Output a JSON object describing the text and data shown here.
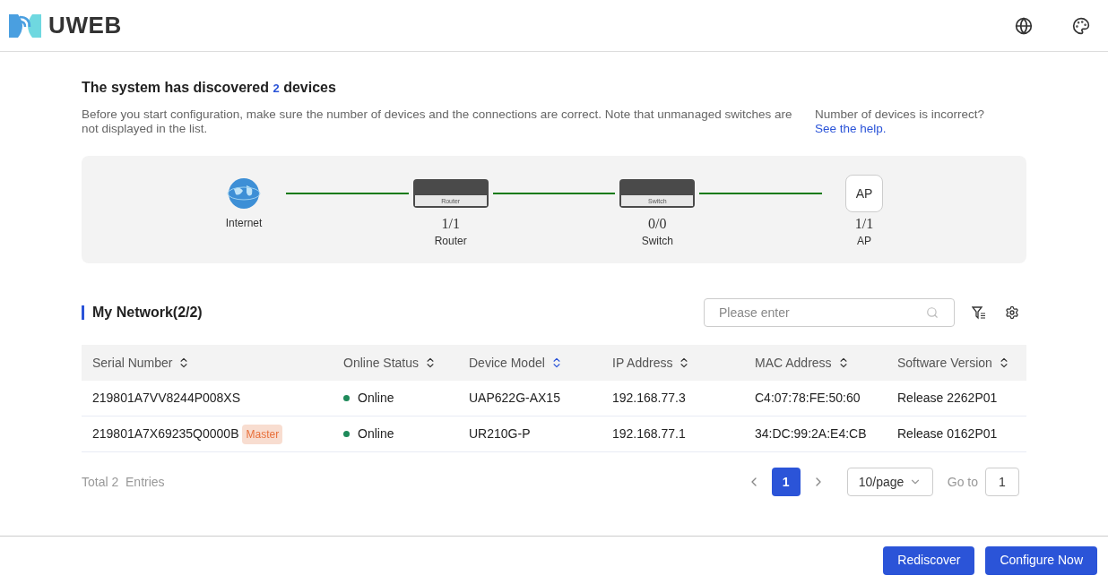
{
  "header": {
    "logo_text": "UWEB"
  },
  "discovery": {
    "title_before": "The system has discovered",
    "count": "2",
    "title_after": "devices",
    "description": "Before you start configuration, make sure the number of devices and the connections are correct. Note that unmanaged switches are not displayed in the list.",
    "help_question": "Number of devices is incorrect?",
    "help_link": "See the help."
  },
  "topology": [
    {
      "kind": "internet",
      "label": "Internet"
    },
    {
      "kind": "router",
      "device_label": "Router",
      "count": "1/1",
      "label": "Router"
    },
    {
      "kind": "switch",
      "device_label": "Switch",
      "count": "0/0",
      "label": "Switch"
    },
    {
      "kind": "ap",
      "device_label": "AP",
      "count": "1/1",
      "label": "AP"
    }
  ],
  "network": {
    "title": "My Network(2/2)",
    "search_placeholder": "Please enter"
  },
  "table": {
    "columns": [
      {
        "label": "Serial Number",
        "sorted": false
      },
      {
        "label": "Online Status",
        "sorted": false
      },
      {
        "label": "Device Model",
        "sorted": true
      },
      {
        "label": "IP Address",
        "sorted": false
      },
      {
        "label": "MAC Address",
        "sorted": false
      },
      {
        "label": "Software Version",
        "sorted": false
      }
    ],
    "rows": [
      {
        "serial": "219801A7VV8244P008XS",
        "tag": null,
        "status": "Online",
        "color": "#1e8a5a",
        "model": "UAP622G-AX15",
        "ip": "192.168.77.3",
        "mac": "C4:07:78:FE:50:60",
        "version": "Release 2262P01"
      },
      {
        "serial": "219801A7X69235Q0000B",
        "tag": "Master",
        "status": "Online",
        "color": "#1e8a5a",
        "model": "UR210G-P",
        "ip": "192.168.77.1",
        "mac": "34:DC:99:2A:E4:CB",
        "version": "Release 0162P01"
      }
    ]
  },
  "pagination": {
    "total": "Total 2  Entries",
    "pages": [
      {
        "label": "1",
        "selected": true
      }
    ],
    "page_size": "10/page",
    "goto_label": "Go to",
    "goto_value": "1"
  },
  "buttons": [
    "Rediscover",
    "Configure Now"
  ]
}
